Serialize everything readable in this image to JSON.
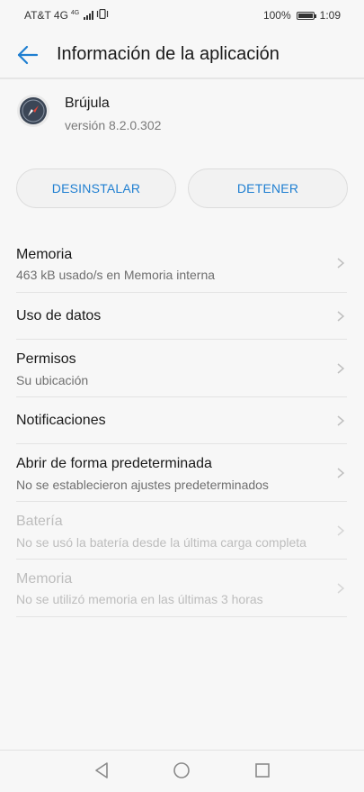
{
  "status_bar": {
    "carrier": "AT&T 4G",
    "net_small": "4G",
    "battery": "100%",
    "time": "1:09"
  },
  "header": {
    "title": "Información de la aplicación"
  },
  "app": {
    "name": "Brújula",
    "version": "versión 8.2.0.302"
  },
  "buttons": {
    "uninstall": "DESINSTALAR",
    "stop": "DETENER"
  },
  "list": [
    {
      "title": "Memoria",
      "subtitle": "463 kB usado/s en Memoria interna",
      "enabled": true
    },
    {
      "title": "Uso de datos",
      "subtitle": "",
      "enabled": true
    },
    {
      "title": "Permisos",
      "subtitle": "Su ubicación",
      "enabled": true
    },
    {
      "title": "Notificaciones",
      "subtitle": "",
      "enabled": true
    },
    {
      "title": "Abrir de forma predeterminada",
      "subtitle": "No se establecieron ajustes predeterminados",
      "enabled": true
    },
    {
      "title": "Batería",
      "subtitle": "No se usó la batería desde la última carga completa",
      "enabled": false
    },
    {
      "title": "Memoria",
      "subtitle": "No se utilizó memoria en las últimas 3 horas",
      "enabled": false
    }
  ],
  "colors": {
    "accent": "#1f7fd1",
    "background": "#f7f7f7",
    "disabled_text": "#bdbdbd"
  },
  "icons": {
    "back": "arrow-left-icon",
    "app": "compass-icon",
    "chevron": "chevron-right-icon",
    "nav_back": "triangle-back-icon",
    "nav_home": "circle-home-icon",
    "nav_recent": "square-recent-icon"
  }
}
